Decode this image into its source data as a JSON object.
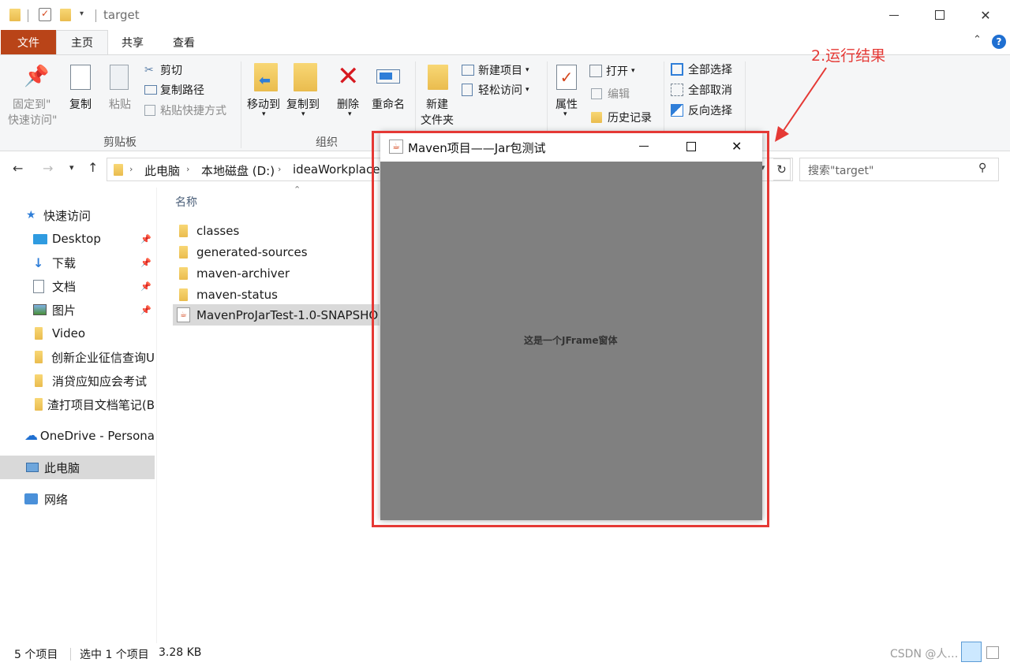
{
  "window": {
    "title": "target",
    "controls": {
      "minimize": "—",
      "maximize": "☐",
      "close": "✕"
    }
  },
  "menu": {
    "tabs": [
      "文件",
      "主页",
      "共享",
      "查看"
    ]
  },
  "ribbon": {
    "clipboard": {
      "pin_line1": "固定到\"",
      "pin_line2": "快速访问\"",
      "copy": "复制",
      "paste": "粘贴",
      "cut": "剪切",
      "copy_path": "复制路径",
      "paste_shortcut": "粘贴快捷方式",
      "group": "剪贴板"
    },
    "organize": {
      "move_to": "移动到",
      "copy_to": "复制到",
      "delete": "删除",
      "rename": "重命名",
      "group": "组织"
    },
    "new": {
      "new_folder_line1": "新建",
      "new_folder_line2": "文件夹",
      "new_item": "新建项目",
      "easy_access": "轻松访问"
    },
    "open": {
      "properties": "属性",
      "open": "打开",
      "edit": "编辑",
      "history": "历史记录"
    },
    "select": {
      "select_all": "全部选择",
      "select_none": "全部取消",
      "invert": "反向选择"
    }
  },
  "address": {
    "breadcrumb": [
      "此电脑",
      "本地磁盘 (D:)",
      "ideaWorkplace"
    ],
    "search_placeholder": "搜索\"target\""
  },
  "sidebar": {
    "items": [
      {
        "label": "快速访问",
        "icon": "star-icon"
      },
      {
        "label": "Desktop",
        "icon": "desktop-icon",
        "pinned": true
      },
      {
        "label": "下载",
        "icon": "download-icon",
        "pinned": true
      },
      {
        "label": "文档",
        "icon": "document-icon",
        "pinned": true
      },
      {
        "label": "图片",
        "icon": "picture-icon",
        "pinned": true
      },
      {
        "label": "Video",
        "icon": "folder-icon"
      },
      {
        "label": "创新企业征信查询U",
        "icon": "folder-icon"
      },
      {
        "label": "消贷应知应会考试",
        "icon": "folder-icon"
      },
      {
        "label": "渣打项目文档笔记(B",
        "icon": "folder-icon"
      },
      {
        "label": "OneDrive - Persona",
        "icon": "cloud-icon"
      },
      {
        "label": "此电脑",
        "icon": "computer-icon"
      },
      {
        "label": "网络",
        "icon": "network-icon"
      }
    ]
  },
  "filelist": {
    "column_name": "名称",
    "files": [
      {
        "name": "classes",
        "icon": "folder-icon"
      },
      {
        "name": "generated-sources",
        "icon": "folder-icon"
      },
      {
        "name": "maven-archiver",
        "icon": "folder-icon"
      },
      {
        "name": "maven-status",
        "icon": "folder-icon"
      },
      {
        "name": "MavenProJarTest-1.0-SNAPSHO",
        "icon": "java-jar-icon"
      }
    ]
  },
  "status": {
    "count": "5 个项目",
    "selected": "选中 1 个项目",
    "size": "3.28 KB"
  },
  "jframe": {
    "title": "Maven项目——Jar包测试",
    "content": "这是一个JFrame窗体"
  },
  "annotation": {
    "text": "2.运行结果",
    "color": "#e53935"
  },
  "watermark": "CSDN @人…"
}
